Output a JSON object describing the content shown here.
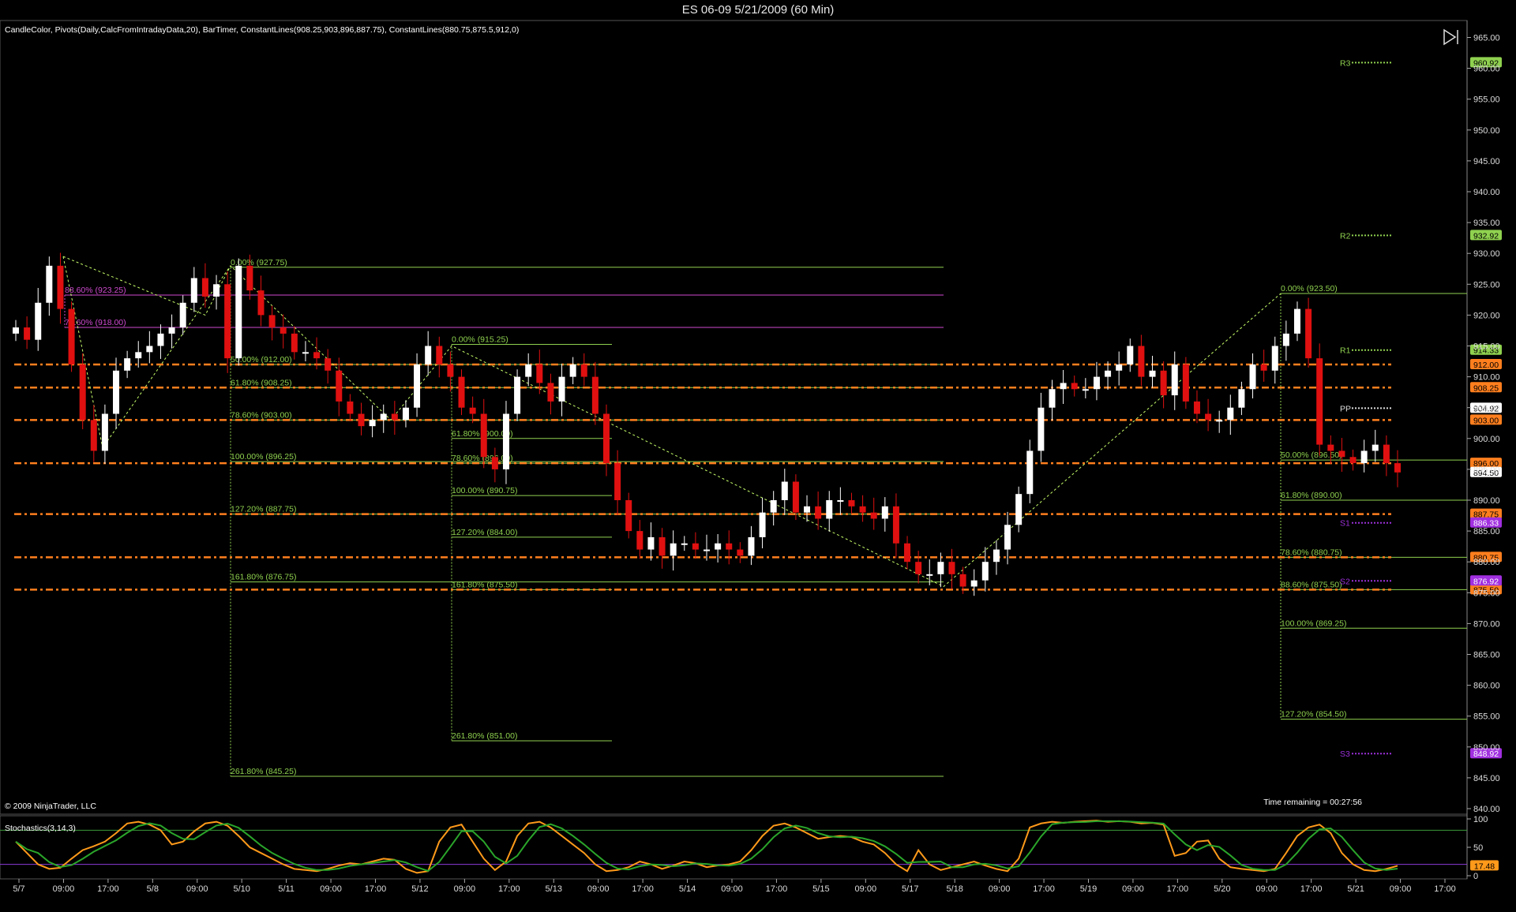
{
  "window": {
    "title": "ES 06-09  5/21/2009 (60 Min)"
  },
  "indicators_label": "CandleColor, Pivots(Daily,CalcFromIntradayData,20), BarTimer, ConstantLines(908.25,903,896,887.75), ConstantLines(880.75,875.5,912,0)",
  "copyright": "© 2009 NinjaTrader, LLC",
  "time_remaining": "Time remaining = 00:27:56",
  "stochastics_label": "Stochastics(3,14,3)",
  "colors": {
    "background": "#000000",
    "up_candle": "#ffffff",
    "down_candle": "#e01010",
    "constant_line": "#ff7f1e",
    "fib": "#8fd14f",
    "fib_magenta": "#d04ad0",
    "pivot_green": "#8fd14f",
    "pivot_purple": "#9b30d9",
    "stoch_k": "#ff9a1a",
    "stoch_d": "#2aa52a"
  },
  "chart_data": {
    "type": "candlestick",
    "instrument": "ES 06-09",
    "interval": "60 Min",
    "ylim": [
      840,
      965
    ],
    "y_ticks": [
      "965.00",
      "960.00",
      "955.00",
      "950.00",
      "945.00",
      "940.00",
      "935.00",
      "930.00",
      "925.00",
      "920.00",
      "915.00",
      "910.00",
      "905.00",
      "900.00",
      "895.00",
      "890.00",
      "885.00",
      "880.00",
      "875.00",
      "870.00",
      "865.00",
      "860.00",
      "855.00",
      "850.00",
      "845.00",
      "840.00"
    ],
    "x_ticks": [
      "5/7",
      "09:00",
      "17:00",
      "5/8",
      "09:00",
      "5/10",
      "5/11",
      "09:00",
      "17:00",
      "5/12",
      "09:00",
      "17:00",
      "5/13",
      "09:00",
      "17:00",
      "5/14",
      "09:00",
      "17:00",
      "5/15",
      "09:00",
      "5/17",
      "5/18",
      "09:00",
      "17:00",
      "5/19",
      "09:00",
      "17:00",
      "5/20",
      "09:00",
      "17:00",
      "5/21",
      "09:00",
      "17:00"
    ],
    "close_path": [
      918,
      916,
      922,
      928,
      921,
      912,
      903,
      898,
      904,
      911,
      913,
      914,
      915,
      917,
      918,
      922,
      926,
      923,
      925,
      913,
      928,
      924,
      920,
      918,
      917,
      914,
      914,
      913,
      911,
      906,
      904,
      902,
      903,
      904,
      903,
      905,
      912,
      915,
      912,
      910,
      905,
      904,
      897,
      895,
      904,
      910,
      912,
      909,
      906,
      910,
      912,
      910,
      904,
      896,
      890,
      885,
      882,
      884,
      881,
      883,
      883,
      882,
      882,
      883,
      882,
      881,
      884,
      888,
      890,
      893,
      888,
      889,
      887,
      890,
      890,
      889,
      888,
      887,
      889,
      883,
      880,
      878,
      878,
      880,
      878,
      876,
      877,
      880,
      882,
      886,
      891,
      898,
      905,
      908,
      909,
      908,
      908,
      910,
      911,
      912,
      915,
      910,
      911,
      907,
      912,
      906,
      904,
      903,
      903,
      905,
      908,
      912,
      911,
      915,
      917,
      921,
      913,
      899,
      898,
      897,
      896,
      898,
      899,
      896,
      894.5
    ],
    "constant_lines": [
      {
        "value": 912.0,
        "label": "912.00"
      },
      {
        "value": 908.25,
        "label": "908.25"
      },
      {
        "value": 903.0,
        "label": "903.00"
      },
      {
        "value": 896.0,
        "label": "896.00"
      },
      {
        "value": 887.75,
        "label": "887.75"
      },
      {
        "value": 880.75,
        "label": "880.75"
      },
      {
        "value": 875.5,
        "label": "875.50"
      }
    ],
    "pivots": [
      {
        "name": "R3",
        "value": 960.92,
        "label": "960.92"
      },
      {
        "name": "R2",
        "value": 932.92,
        "label": "932.92"
      },
      {
        "name": "R1",
        "value": 914.33,
        "label": "914.33"
      },
      {
        "name": "PP",
        "value": 904.92,
        "label": "904.92"
      },
      {
        "name": "S1",
        "value": 886.33,
        "label": "886.33"
      },
      {
        "name": "S2",
        "value": 876.92,
        "label": "876.92"
      },
      {
        "name": "S3",
        "value": 848.92,
        "label": "848.92"
      }
    ],
    "last_price": {
      "value": 894.5,
      "label": "894.50"
    },
    "fib_sets": [
      {
        "color": "magenta",
        "levels": [
          {
            "value": 923.25,
            "text": "88.60% (923.25)"
          },
          {
            "value": 918.0,
            "text": "78.60% (918.00)"
          }
        ]
      },
      {
        "color": "green",
        "levels": [
          {
            "value": 927.75,
            "text": "0.00% (927.75)"
          },
          {
            "value": 912.0,
            "text": "50.00% (912.00)"
          },
          {
            "value": 908.25,
            "text": "61.80% (908.25)"
          },
          {
            "value": 903.0,
            "text": "78.60% (903.00)"
          },
          {
            "value": 896.25,
            "text": "100.00% (896.25)"
          },
          {
            "value": 887.75,
            "text": "127.20% (887.75)"
          },
          {
            "value": 876.75,
            "text": "161.80% (876.75)"
          },
          {
            "value": 845.25,
            "text": "261.80% (845.25)"
          }
        ]
      },
      {
        "color": "green",
        "levels": [
          {
            "value": 915.25,
            "text": "0.00% (915.25)"
          },
          {
            "value": 900.0,
            "text": "61.80% (900.00)"
          },
          {
            "value": 896.0,
            "text": "78.60% (896.00)"
          },
          {
            "value": 890.75,
            "text": "100.00% (890.75)"
          },
          {
            "value": 884.0,
            "text": "127.20% (884.00)"
          },
          {
            "value": 875.5,
            "text": "161.80% (875.50)"
          },
          {
            "value": 851.0,
            "text": "261.80% (851.00)"
          }
        ]
      },
      {
        "color": "green",
        "levels": [
          {
            "value": 923.5,
            "text": "0.00% (923.50)"
          },
          {
            "value": 896.5,
            "text": "50.00% (896.50)"
          },
          {
            "value": 890.0,
            "text": "61.80% (890.00)"
          },
          {
            "value": 880.75,
            "text": "78.60% (880.75)"
          },
          {
            "value": 875.5,
            "text": "88.60% (875.50)"
          },
          {
            "value": 869.25,
            "text": "100.00% (869.25)"
          },
          {
            "value": 854.5,
            "text": "127.20% (854.50)"
          }
        ]
      }
    ],
    "stochastics": {
      "ylim": [
        0,
        100
      ],
      "y_ticks": [
        "100",
        "50",
        "0"
      ],
      "last_value": 17.48,
      "last_label": "17.48",
      "k": [
        60,
        40,
        20,
        12,
        14,
        30,
        45,
        52,
        60,
        75,
        92,
        95,
        90,
        80,
        55,
        60,
        78,
        92,
        95,
        88,
        70,
        50,
        40,
        30,
        20,
        12,
        10,
        8,
        12,
        18,
        22,
        20,
        25,
        30,
        28,
        12,
        5,
        8,
        60,
        85,
        90,
        60,
        30,
        10,
        25,
        70,
        92,
        95,
        85,
        70,
        55,
        40,
        20,
        8,
        10,
        15,
        25,
        20,
        12,
        18,
        25,
        22,
        15,
        18,
        20,
        25,
        45,
        70,
        88,
        92,
        85,
        75,
        65,
        68,
        70,
        68,
        60,
        55,
        40,
        20,
        8,
        45,
        20,
        10,
        15,
        20,
        25,
        18,
        12,
        8,
        30,
        85,
        92,
        95,
        93,
        95,
        96,
        97,
        95,
        96,
        95,
        92,
        93,
        90,
        35,
        40,
        60,
        62,
        30,
        15,
        12,
        10,
        8,
        12,
        40,
        70,
        85,
        90,
        75,
        40,
        20,
        10,
        8,
        12,
        17.48
      ]
    }
  }
}
